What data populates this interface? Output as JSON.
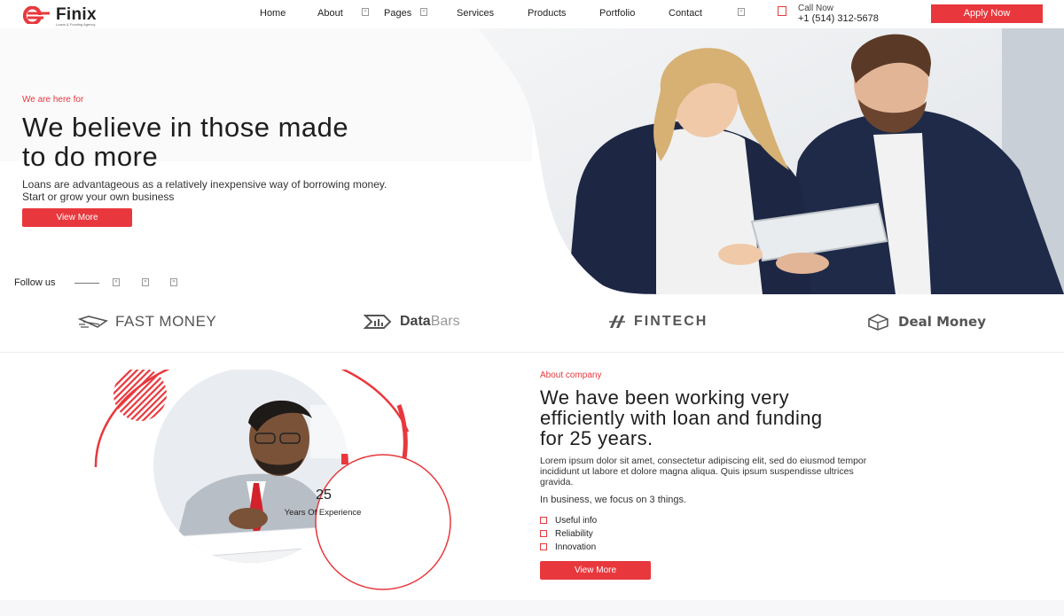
{
  "brand": {
    "name": "Finix",
    "tagline": "Loans & Funding Agency",
    "accent_color": "#e8383d"
  },
  "nav": {
    "items": [
      {
        "label": "Home"
      },
      {
        "label": "About"
      },
      {
        "label": "Pages"
      },
      {
        "label": "Services"
      },
      {
        "label": "Products"
      },
      {
        "label": "Portfolio"
      },
      {
        "label": "Contact"
      }
    ],
    "search_icon": "search-icon"
  },
  "header": {
    "call_label": "Call Now",
    "call_number": "+1 (514) 312-5678",
    "apply_label": "Apply Now"
  },
  "hero": {
    "eyebrow": "We are here for",
    "title_line1": "We believe in those made",
    "title_line2": "to do more",
    "text_line1": "Loans are advantageous as a relatively inexpensive way of borrowing money.",
    "text_line2": "Start or grow your own business",
    "button_label": "View More",
    "follow_label": "Follow us",
    "social_icons": [
      "facebook-icon",
      "twitter-icon",
      "instagram-icon"
    ]
  },
  "partners": [
    {
      "name": "FAST MONEY",
      "icon": "fast-money-logo-icon"
    },
    {
      "name_bold": "Data",
      "name_light": " Bars",
      "icon": "data-bars-logo-icon"
    },
    {
      "name": "FINTECH",
      "icon": "fintech-logo-icon"
    },
    {
      "name": "Deal Money",
      "icon": "deal-money-logo-icon"
    }
  ],
  "about": {
    "eyebrow": "About company",
    "title_line1": "We have been working very",
    "title_line2": "efficiently with loan and funding",
    "title_line3": "for 25 years.",
    "desc_line1": "Lorem ipsum dolor sit amet, consectetur adipiscing elit, sed do eiusmod tempor",
    "desc_line2": "incididunt ut labore et dolore magna aliqua. Quis ipsum suspendisse ultrices",
    "desc_line3": "gravida.",
    "focus_text": "In business, we focus on 3 things.",
    "features": [
      "Useful info",
      "Reliability",
      "Innovation"
    ],
    "button_label": "View More",
    "experience_number": "25",
    "experience_label": "Years Of Experience"
  }
}
